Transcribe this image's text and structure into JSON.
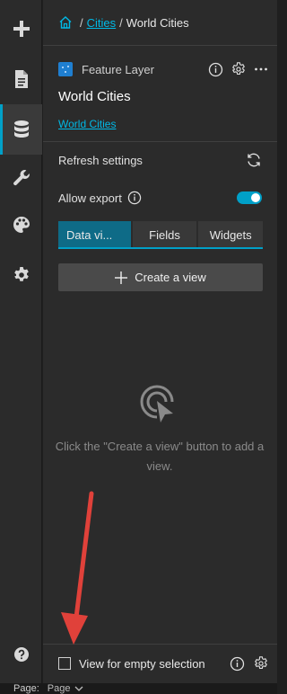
{
  "toolbar": {
    "items": [
      {
        "name": "add-icon"
      },
      {
        "name": "page-icon"
      },
      {
        "name": "data-icon",
        "active": true
      },
      {
        "name": "widget-icon"
      },
      {
        "name": "theme-icon"
      },
      {
        "name": "settings-icon"
      }
    ],
    "help_icon": "help-icon"
  },
  "breadcrumb": {
    "home_icon": "home-icon",
    "sep1": "/",
    "parent": "Cities",
    "sep2": "/",
    "current": "World Cities"
  },
  "layer": {
    "type_label": "Feature Layer",
    "name": "World Cities",
    "link": "World Cities"
  },
  "settings": {
    "refresh_label": "Refresh settings",
    "export_label": "Allow export",
    "export_enabled": true
  },
  "tabs": [
    {
      "label": "Data vi...",
      "active": true
    },
    {
      "label": "Fields",
      "active": false
    },
    {
      "label": "Widgets",
      "active": false
    }
  ],
  "create_view": {
    "label": "Create a view"
  },
  "empty_state": {
    "message": "Click the \"Create a view\" button to add a view."
  },
  "bottom": {
    "checkbox_label": "View for empty selection",
    "checked": false
  },
  "footer": {
    "page_label": "Page:",
    "page_value": "Page"
  },
  "colors": {
    "accent": "#00a0c8",
    "link": "#00b9e6",
    "panel_bg": "#2b2b2b",
    "annotation_arrow": "#e0413a"
  }
}
